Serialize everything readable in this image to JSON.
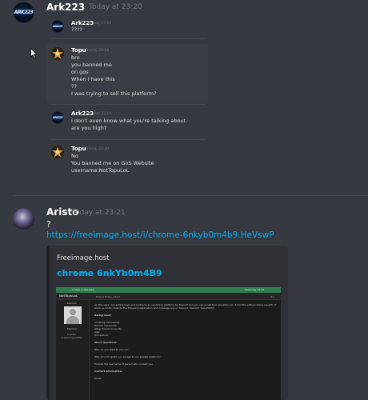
{
  "msg1": {
    "author": "Ark223",
    "timestamp": "Today at 23:20",
    "avatar_text": "ARK223"
  },
  "quoted": [
    {
      "author": "Ark223",
      "timestamp": "Dzisiaj 23:18",
      "lines": [
        "????"
      ]
    },
    {
      "author": "Topu",
      "timestamp": "Dzisiaj 23:18",
      "lines": [
        "bro",
        "you banned me",
        "on gos",
        "When I have this",
        "??",
        "I was trying to sell this platform?"
      ]
    },
    {
      "author": "Ark223",
      "timestamp": "Dzisiaj 23:19",
      "lines": [
        "I don't even know what you're talking about",
        "are you high?"
      ]
    },
    {
      "author": "Topu",
      "timestamp": "Dzisiaj 23:20",
      "lines": [
        "No",
        "You banned me on GoS Website",
        "username:NotTopuLoL"
      ]
    }
  ],
  "msg2": {
    "author": "Aristo",
    "timestamp": "Today at 23:21",
    "text": "?",
    "link": "https://freeimage.host/i/chrome-6nkyb0m4b9.HeVswP",
    "embed": {
      "provider": "Freeimage.host",
      "title": "chrome 6nkYb0m4B9"
    }
  },
  "inner_shot": {
    "topbar_left": "7 days in this topic",
    "topbar_right": "Yesterday 23:22",
    "username": "NotTopuLoL",
    "post_date": "Posted Today, 08:17",
    "post_num": "#1",
    "member_label": "Member",
    "stats": [
      "1 posts",
      "1 warning points"
    ],
    "paragraphs": [
      "As title says I am selling keys and invites to an upcoming platform for Discord and you can script from anywhere (in 3 months without being caught). If",
      "stuck as invite must do the following application and message one on Discord. Discord: Topu#9933",
      "Background:",
      "Scripting Usernames:",
      "Discord Username:",
      "Other Forum Accounts:",
      "Age:",
      "Occupation:",
      "Short Questions:",
      "Why do you want to join us?",
      "Why should I grant you access to our private platform?",
      "Provide the username of person who invited you",
      "Contact information:",
      "Email:"
    ]
  },
  "colors": {
    "background": "#36393f",
    "embed_bg": "#2f3136",
    "link": "#00b0f4",
    "inner_header_green": "#2e7d4f"
  }
}
